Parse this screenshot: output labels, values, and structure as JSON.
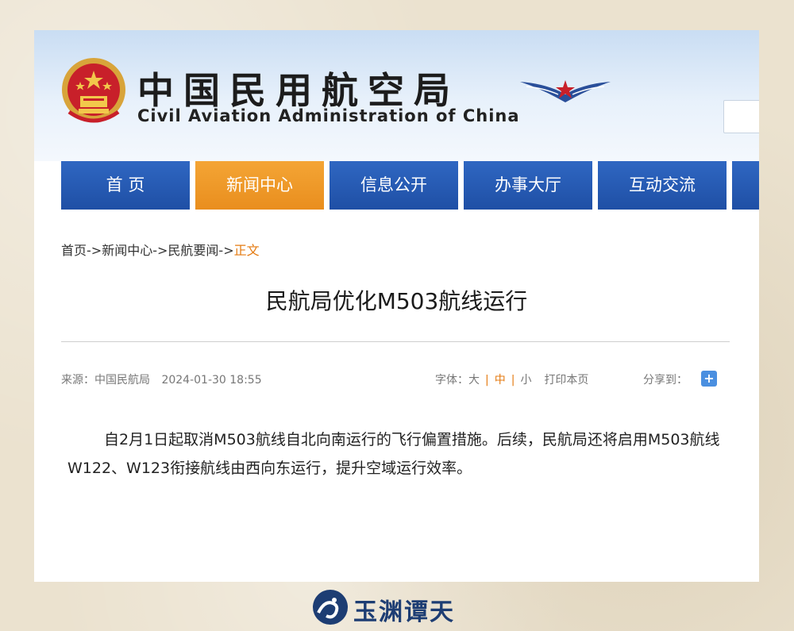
{
  "header": {
    "title_cn": "中国民用航空局",
    "title_en": "Civil Aviation Administration of China"
  },
  "nav": {
    "items": [
      {
        "label": "首 页"
      },
      {
        "label": "新闻中心"
      },
      {
        "label": "信息公开"
      },
      {
        "label": "办事大厅"
      },
      {
        "label": "互动交流"
      }
    ],
    "active_index": 1
  },
  "breadcrumb": {
    "items": [
      "首页",
      "新闻中心",
      "民航要闻"
    ],
    "separator": "->",
    "current": "正文"
  },
  "article": {
    "title": "民航局优化M503航线运行",
    "source_label": "来源：",
    "source": "中国民航局",
    "date": "2024-01-30 18:55",
    "body": "自2月1日起取消M503航线自北向南运行的飞行偏置措施。后续，民航局还将启用M503航线W122、W123衔接航线由西向东运行，提升空域运行效率。"
  },
  "toolbar": {
    "font_label": "字体：",
    "size_large": "大",
    "size_medium": "中",
    "size_small": "小",
    "sep": "|",
    "print": "打印本页",
    "share_label": "分享到：",
    "share_button": "+"
  },
  "watermark": {
    "text": "玉渊谭天"
  },
  "colors": {
    "nav_blue": "#2458b5",
    "nav_active": "#f09a28",
    "accent_orange": "#e47a10"
  },
  "icons": {
    "emblem": "national-emblem-icon",
    "logo": "caac-wings-logo",
    "share": "plus-icon"
  }
}
